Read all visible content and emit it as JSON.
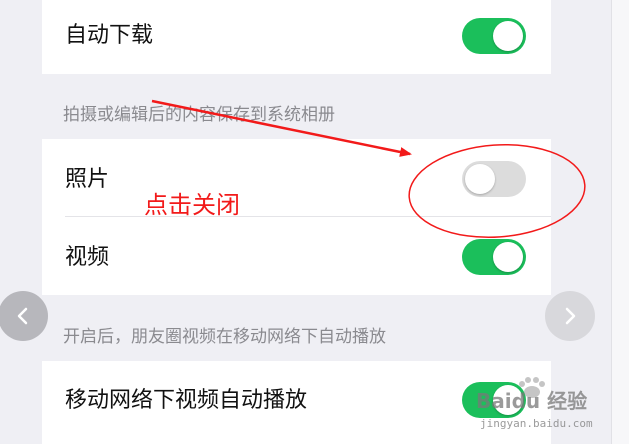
{
  "settings": {
    "auto_download": {
      "label": "自动下载",
      "enabled": true
    },
    "save_section_header": "拍摄或编辑后的内容保存到系统相册",
    "photos": {
      "label": "照片",
      "enabled": false
    },
    "videos": {
      "label": "视频",
      "enabled": true
    },
    "autoplay_section_header": "开启后，朋友圈视频在移动网络下自动播放",
    "mobile_autoplay": {
      "label": "移动网络下视频自动播放",
      "enabled": true
    }
  },
  "annotation": {
    "text": "点击关闭",
    "color": "#f21a1a"
  },
  "watermark": {
    "text": "Baidu 经验",
    "sub": "jingyan.baidu.com"
  },
  "colors": {
    "toggle_on": "#1bbf5b",
    "toggle_off": "#dcdcdc",
    "background": "#efeff4"
  }
}
